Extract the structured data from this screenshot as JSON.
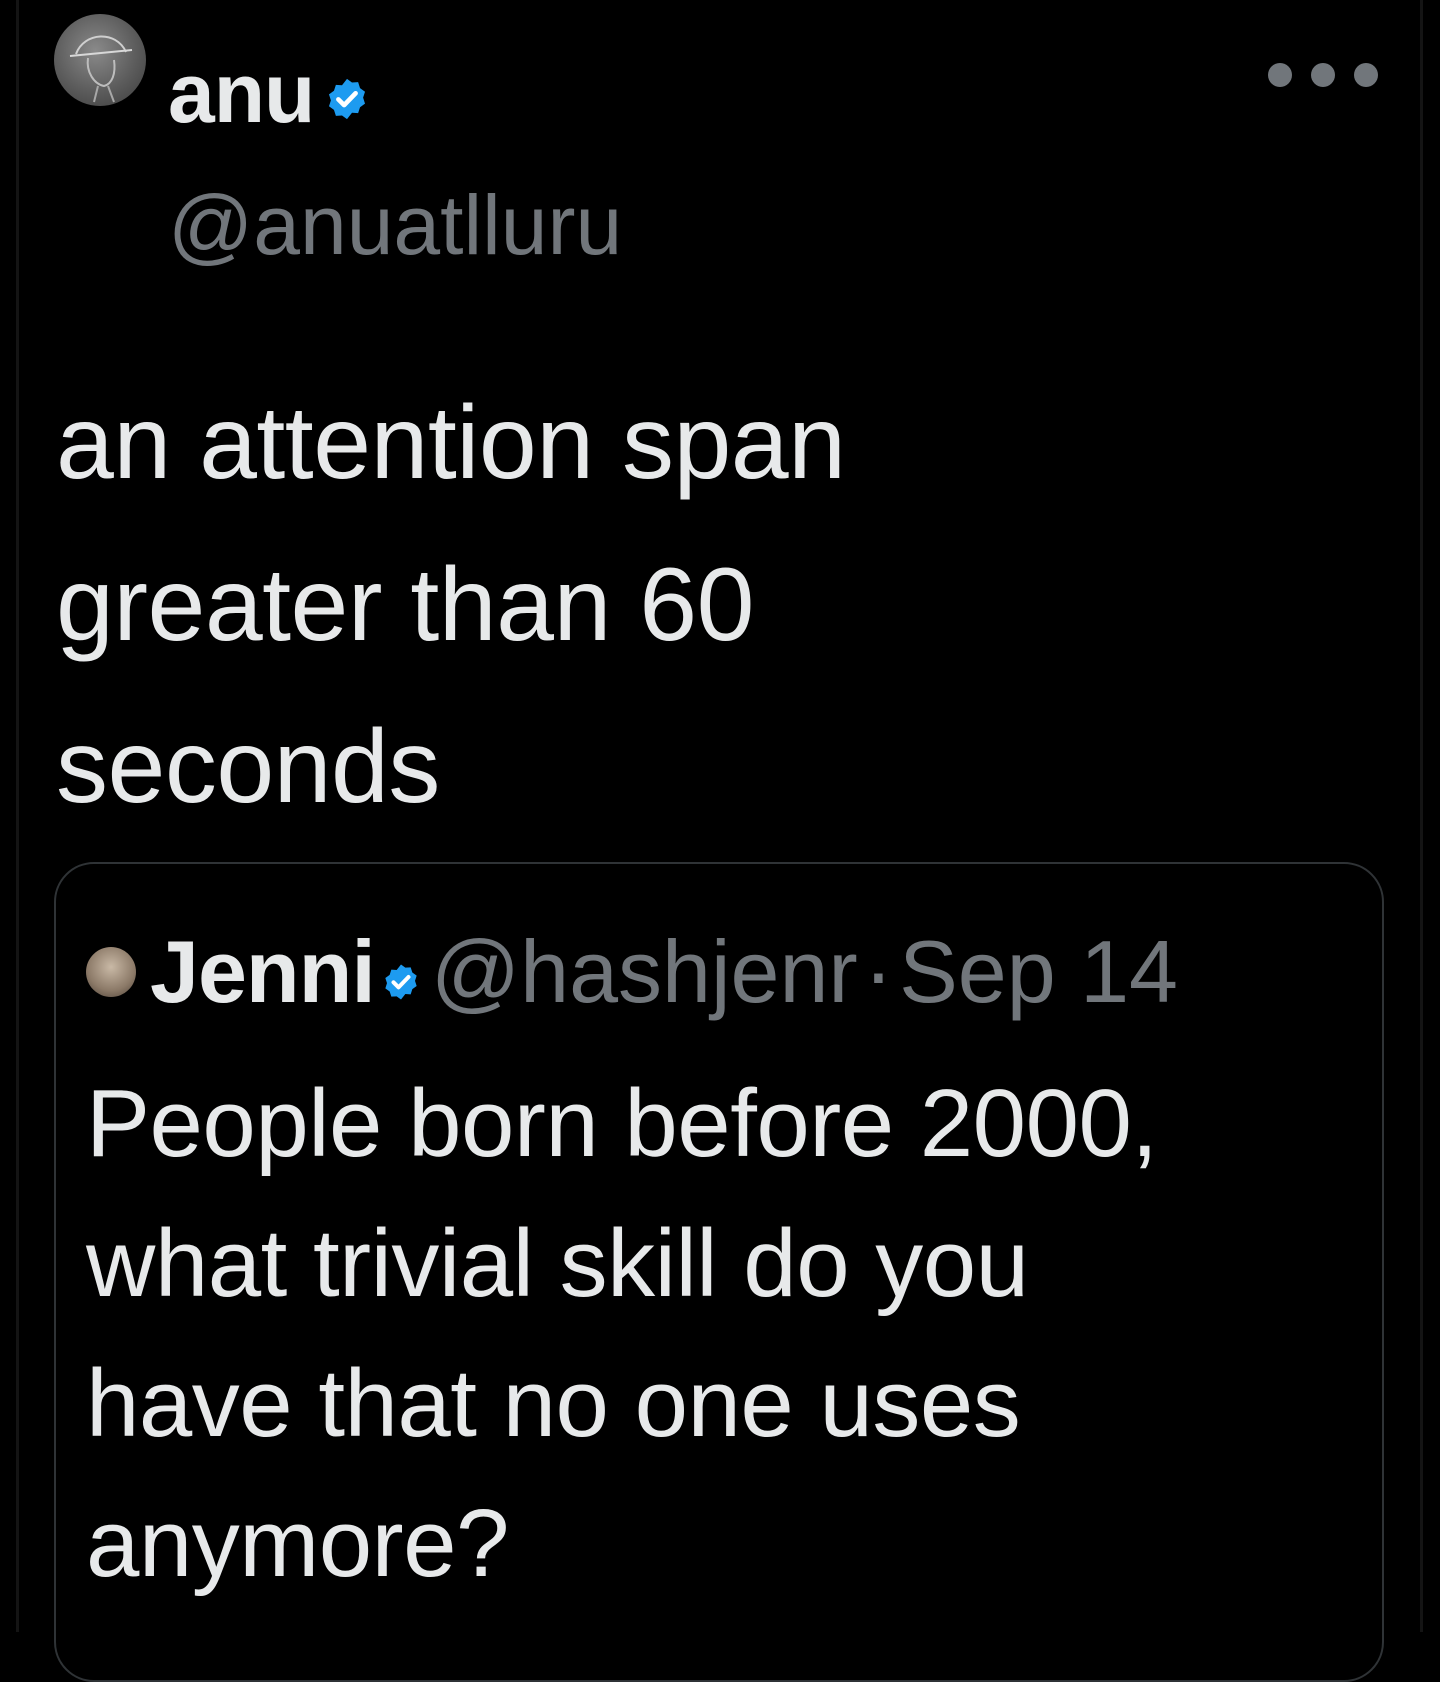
{
  "tweet": {
    "display_name": "anu",
    "handle": "@anuatlluru",
    "verified": true,
    "text_lines": [
      "an attention span",
      "greater than 60",
      "seconds"
    ]
  },
  "quoted_tweet": {
    "display_name": "Jenni",
    "handle": "@hashjenr",
    "separator": "·",
    "date": "Sep 14",
    "verified": true,
    "text_lines": [
      "People born before 2000,",
      "what trivial skill do you",
      "have that no one uses",
      "anymore?"
    ]
  },
  "colors": {
    "background": "#000000",
    "primary_text": "#e7e9ea",
    "secondary_text": "#71767b",
    "verified_badge": "#1d9bf0",
    "card_border": "#2f3336"
  },
  "icons": {
    "verified": "verified-badge-icon",
    "more": "more-options-icon"
  }
}
